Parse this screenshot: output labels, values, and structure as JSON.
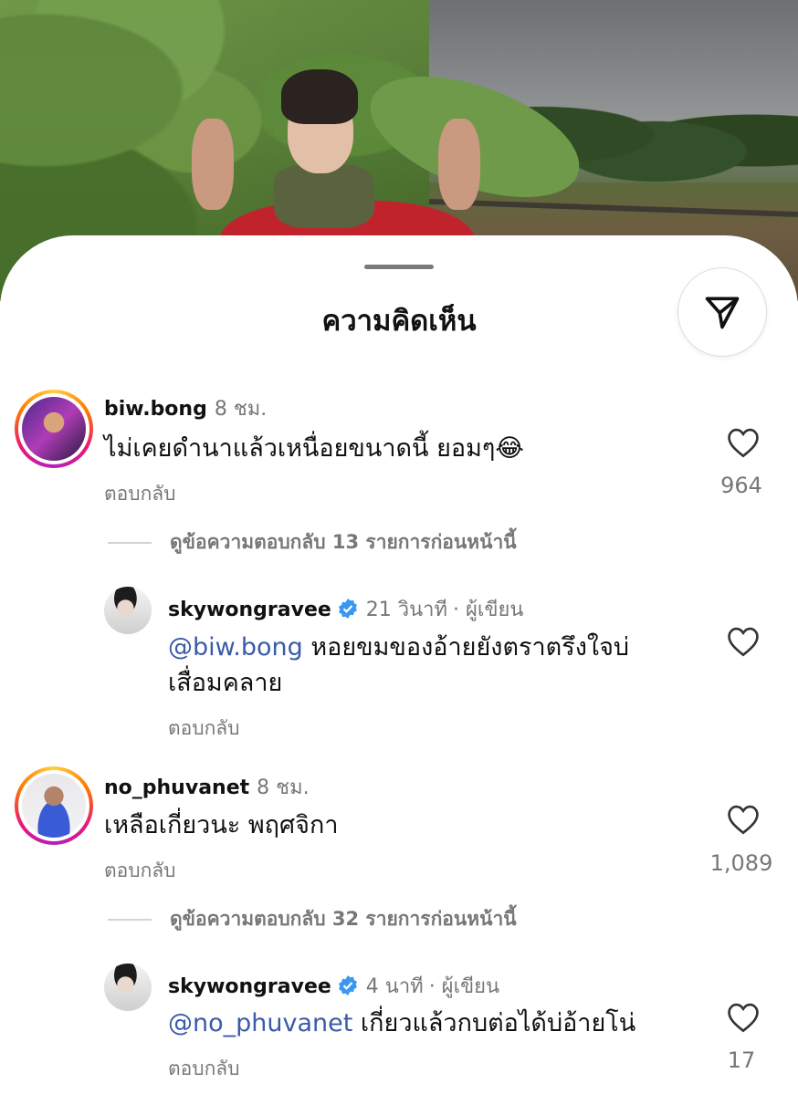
{
  "sheet": {
    "title": "ความคิดเห็น"
  },
  "icons": {
    "send": "paper-plane-icon",
    "like": "heart-outline-icon",
    "verified": "verified-badge-icon"
  },
  "colors": {
    "mention": "#3a5ba8",
    "verified": "#3897f0",
    "muted": "#777777"
  },
  "comments": [
    {
      "username": "biw.bong",
      "time": "8 ชม.",
      "text": "ไม่เคยดำนาแล้วเหนื่อยขนาดนี้ ยอมๆ😂",
      "reply_label": "ตอบกลับ",
      "likes": "964",
      "view_replies": "ดูข้อความตอบกลับ 13 รายการก่อนหน้านี้",
      "author_reply": {
        "username": "skywongravee",
        "time": "21 วินาที",
        "author_tag": "· ผู้เขียน",
        "mention": "@biw.bong",
        "text_line1": " หอยขมของอ้ายยังตราตรึงใจบ่",
        "text_line2": "เสื่อมคลาย",
        "reply_label": "ตอบกลับ"
      }
    },
    {
      "username": "no_phuvanet",
      "time": "8 ชม.",
      "text": "เหลือเกี่ยวนะ พฤศจิกา",
      "reply_label": "ตอบกลับ",
      "likes": "1,089",
      "view_replies": "ดูข้อความตอบกลับ 32 รายการก่อนหน้านี้",
      "author_reply": {
        "username": "skywongravee",
        "time": "4 นาที",
        "author_tag": "· ผู้เขียน",
        "mention": "@no_phuvanet",
        "text": " เกี่ยวแล้วกบต่อได้บ่อ้ายโน่",
        "reply_label": "ตอบกลับ",
        "likes": "17"
      }
    }
  ]
}
